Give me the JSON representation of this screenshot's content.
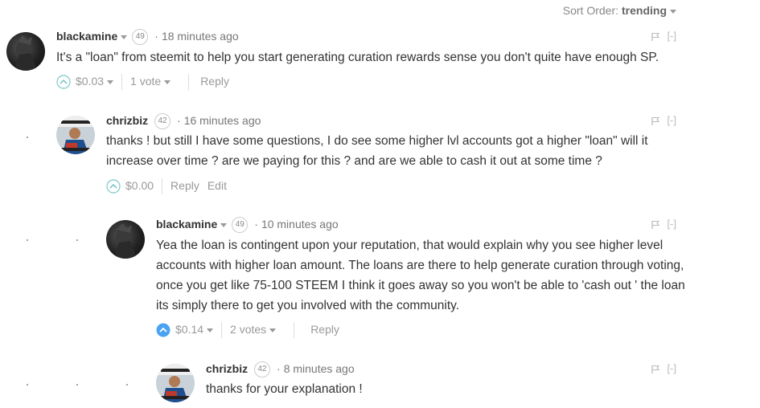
{
  "sort": {
    "label": "Sort Order:",
    "value": "trending"
  },
  "comments": [
    {
      "author": "blackamine",
      "reputation": "49",
      "time": "18 minutes ago",
      "body": "It's a \"loan\" from steemit to help you start generating curation rewards sense you don't quite have enough SP.",
      "payout": "$0.03",
      "votes": "1 vote",
      "reply": "Reply",
      "collapse": "[-]",
      "upvoted": false
    },
    {
      "author": "chrizbiz",
      "reputation": "42",
      "time": "16 minutes ago",
      "body": "thanks ! but still I have some questions, I do see some higher lvl accounts got a higher \"loan\" will it increase over time ? are we paying for this ? and are we able to cash it out at some time ?",
      "payout": "$0.00",
      "reply": "Reply",
      "edit": "Edit",
      "collapse": "[-]",
      "upvoted": false
    },
    {
      "author": "blackamine",
      "reputation": "49",
      "time": "10 minutes ago",
      "body": "Yea the loan is contingent upon your reputation, that would explain why you see higher level accounts with higher loan amount. The loans are there to help generate curation through voting, once you get like 75-100 STEEM I think it goes away so you won't be able to 'cash out ' the loan its simply there to get you involved with the community.",
      "payout": "$0.14",
      "votes": "2 votes",
      "reply": "Reply",
      "collapse": "[-]",
      "upvoted": true
    },
    {
      "author": "chrizbiz",
      "reputation": "42",
      "time": "8 minutes ago",
      "body": "thanks for your explanation !",
      "collapse": "[-]"
    }
  ],
  "colors": {
    "accent": "#1a5099",
    "upvote_active": "#4ba2f2",
    "upvote_inactive": "#7ec8c8",
    "muted": "#999999"
  },
  "icons": {
    "upvote": "chevron-up-circle-icon",
    "flag": "flag-icon",
    "dropdown": "caret-down-icon"
  }
}
